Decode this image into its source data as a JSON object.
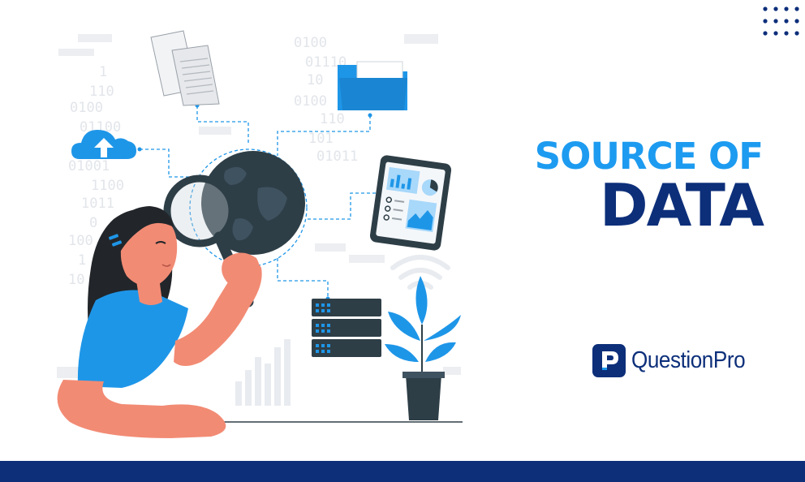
{
  "headline": {
    "line1": "SOURCE OF",
    "line2": "DATA"
  },
  "logo": {
    "name": "QuestionPro"
  },
  "binary_text": [
    "0100",
    "01110",
    "1",
    "110",
    "0100",
    "01100",
    "01001",
    "1100",
    "1011",
    "0",
    "100",
    "1",
    "10",
    "10",
    "0100",
    "110",
    "101",
    "01011"
  ],
  "colors": {
    "accent_light": "#1d9bf0",
    "accent_dark": "#0d2f7a",
    "skin": "#f28b74",
    "shirt": "#1e96e8",
    "hair": "#22262a",
    "globe": "#2e3e47",
    "server": "#2e3e47"
  },
  "icons": [
    "documents-icon",
    "folder-icon",
    "cloud-upload-icon",
    "globe-icon",
    "magnifier-icon",
    "tablet-icon",
    "wifi-icon",
    "server-icon",
    "plant-icon",
    "bar-chart-icon",
    "dot-grid-icon"
  ]
}
